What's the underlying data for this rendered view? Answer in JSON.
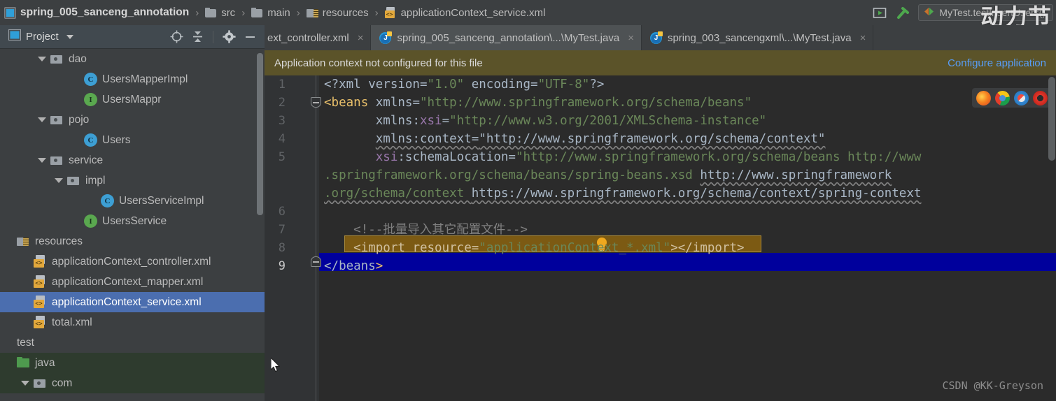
{
  "breadcrumb": {
    "items": [
      {
        "label": "spring_005_sanceng_annotation",
        "icon": "module-icon"
      },
      {
        "label": "src",
        "icon": "folder-icon"
      },
      {
        "label": "main",
        "icon": "folder-icon"
      },
      {
        "label": "resources",
        "icon": "resources-folder-icon"
      },
      {
        "label": "applicationContext_service.xml",
        "icon": "xml-file-icon"
      }
    ],
    "separator": "›"
  },
  "toolbar": {
    "run_icon": "run-icon",
    "build_icon": "build-hammer-icon",
    "run_config": "MyTest.testInsertUsers()",
    "run_config_icon": "run-config-icon"
  },
  "sidebar": {
    "title": "Project",
    "tools": [
      {
        "name": "select-opened-file-icon"
      },
      {
        "name": "collapse-all-icon"
      },
      {
        "name": "gear-icon"
      },
      {
        "name": "hide-icon"
      }
    ],
    "tree": [
      {
        "label": "dao",
        "indent": 2,
        "arrow": "down",
        "icon": "package-icon",
        "type": "package"
      },
      {
        "label": "UsersMapperImpl",
        "indent": 4,
        "arrow": "none",
        "icon": "class-icon",
        "type": "class"
      },
      {
        "label": "UsersMappr",
        "indent": 4,
        "arrow": "none",
        "icon": "interface-icon",
        "type": "interface"
      },
      {
        "label": "pojo",
        "indent": 2,
        "arrow": "down",
        "icon": "package-icon",
        "type": "package"
      },
      {
        "label": "Users",
        "indent": 4,
        "arrow": "none",
        "icon": "class-icon",
        "type": "class"
      },
      {
        "label": "service",
        "indent": 2,
        "arrow": "down",
        "icon": "package-icon",
        "type": "package"
      },
      {
        "label": "impl",
        "indent": 3,
        "arrow": "down",
        "icon": "package-icon",
        "type": "package"
      },
      {
        "label": "UsersServiceImpl",
        "indent": 5,
        "arrow": "none",
        "icon": "class-icon",
        "type": "class"
      },
      {
        "label": "UsersService",
        "indent": 4,
        "arrow": "none",
        "icon": "interface-icon",
        "type": "interface"
      },
      {
        "label": "resources",
        "indent": 0,
        "arrow": "none",
        "icon": "resources-folder-icon",
        "type": "folder"
      },
      {
        "label": "applicationContext_controller.xml",
        "indent": 1,
        "arrow": "none",
        "icon": "xml-file-icon",
        "type": "file"
      },
      {
        "label": "applicationContext_mapper.xml",
        "indent": 1,
        "arrow": "none",
        "icon": "xml-file-icon",
        "type": "file"
      },
      {
        "label": "applicationContext_service.xml",
        "indent": 1,
        "arrow": "none",
        "icon": "xml-file-icon",
        "type": "file",
        "selected": true
      },
      {
        "label": "total.xml",
        "indent": 1,
        "arrow": "none",
        "icon": "xml-file-icon",
        "type": "file"
      },
      {
        "label": "test",
        "indent": 0,
        "arrow": "none",
        "icon": "none",
        "type": "plain"
      },
      {
        "label": "java",
        "indent": 0,
        "arrow": "none",
        "icon": "green-folder-icon",
        "type": "sourceroot"
      },
      {
        "label": "com",
        "indent": 1,
        "arrow": "down",
        "icon": "package-icon",
        "type": "package"
      }
    ]
  },
  "editor": {
    "tabs": [
      {
        "label": "ext_controller.xml",
        "icon": "none",
        "active": false,
        "clipped": true,
        "close": "×"
      },
      {
        "label": "spring_005_sanceng_annotation\\...\\MyTest.java",
        "icon": "idea-java-icon",
        "active": true,
        "close": "×"
      },
      {
        "label": "spring_003_sancengxml\\...\\MyTest.java",
        "icon": "idea-java-icon",
        "active": false,
        "close": "×"
      }
    ],
    "notification": {
      "message": "Application context not configured for this file",
      "action": "Configure application"
    },
    "line_numbers": [
      "1",
      "2",
      "3",
      "4",
      "5",
      "6",
      "7",
      "8",
      "9"
    ],
    "code_lines": [
      "<?xml version=\"1.0\" encoding=\"UTF-8\"?>",
      "<beans xmlns=\"http://www.springframework.org/schema/beans\"",
      "       xmlns:xsi=\"http://www.w3.org/2001/XMLSchema-instance\"",
      "       xmlns:context=\"http://www.springframework.org/schema/context\"",
      "       xsi:schemaLocation=\"http://www.springframework.org/schema/beans http://www.springframework.org/schema/beans/spring-beans.xsd http://www.springframework.org/schema/context https://www.springframework.org/schema/context/spring-context",
      "",
      "    <!--批量导入其它配置文件-->",
      "    <import resource=\"applicationContext_*.xml\"></import>",
      "</beans>"
    ],
    "tokens": {
      "l1_a": "<?xml version=",
      "l1_b": "\"1.0\"",
      "l1_c": " encoding=",
      "l1_d": "\"UTF-8\"",
      "l1_e": "?>",
      "l2_lt": "<",
      "l2_tag": "beans",
      "l2_attr": " xmlns=",
      "l2_val": "\"http://www.springframework.org/schema/beans\"",
      "l3_attr_a": "xmlns:",
      "l3_attr_b": "xsi",
      "l3_eq": "=",
      "l3_val": "\"http://www.w3.org/2001/XMLSchema-instance\"",
      "l4_attr": "xmlns:context=",
      "l4_val": "\"http://www.springframework.org/schema/context\"",
      "l5_attr_a": "xsi",
      "l5_attr_b": ":schemaLocation=",
      "l5_val1": "\"http://www.springframework.org/schema/beans http://www",
      "l5_val2": ".springframework.org/schema/beans/spring-beans.xsd ",
      "l5_val3": "http://www.springframework",
      "l5_val4": ".org/schema/context ",
      "l5_val5": "https://www.springframework.org/schema/context/spring-context",
      "l7_comment": "<!--批量导入其它配置文件-->",
      "l8_a": "<import resource=",
      "l8_b": "\"applicationContext_*.xml\"",
      "l8_c": "></import>",
      "l9_a": "</beans",
      "l9_b": ">"
    },
    "browser_preview": [
      "firefox-icon",
      "chrome-icon",
      "safari-icon",
      "opera-icon"
    ],
    "gutter_bulb": "intention-bulb-icon"
  },
  "watermarks": {
    "chinese": "动力节",
    "csdn": "CSDN @KK-Greyson"
  },
  "colors": {
    "accent_blue": "#4b6eaf",
    "selection_line": "#00009c",
    "warn_highlight": "#7c5a13",
    "notification_bg": "#5b5329",
    "link": "#589df6",
    "editor_bg": "#2b2b2b",
    "panel_bg": "#3c3f41"
  }
}
